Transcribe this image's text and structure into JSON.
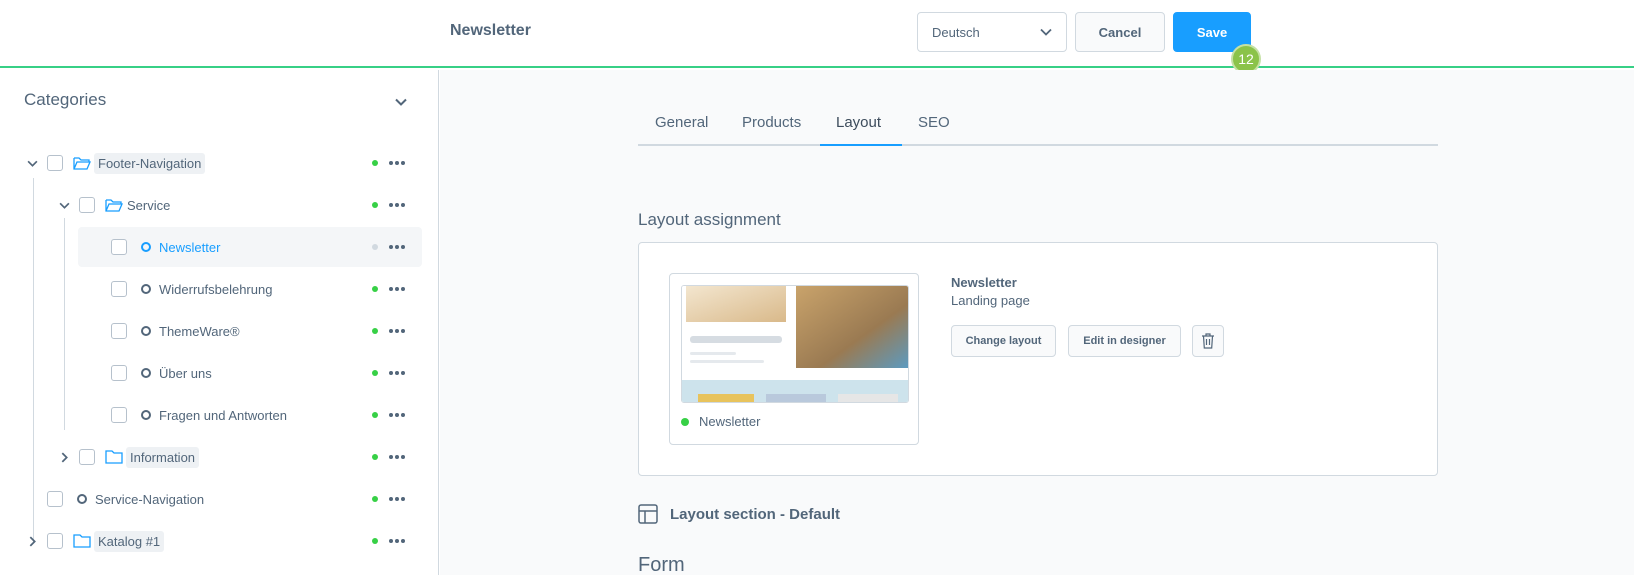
{
  "header": {
    "title": "Newsletter",
    "language": "Deutsch",
    "cancel_label": "Cancel",
    "save_label": "Save",
    "badge": "12"
  },
  "sidebar": {
    "title": "Categories",
    "items": [
      {
        "label": "Footer-Navigation",
        "type": "folder",
        "expanded": true,
        "status": "active"
      },
      {
        "label": "Service",
        "type": "folder",
        "expanded": true,
        "status": "active"
      },
      {
        "label": "Newsletter",
        "type": "page",
        "selected": true,
        "status": "inactive"
      },
      {
        "label": "Widerrufsbelehrung",
        "type": "page",
        "status": "active"
      },
      {
        "label": "ThemeWare®",
        "type": "page",
        "status": "active"
      },
      {
        "label": "Über uns",
        "type": "page",
        "status": "active"
      },
      {
        "label": "Fragen und Antworten",
        "type": "page",
        "status": "active"
      },
      {
        "label": "Information",
        "type": "folder",
        "expanded": false,
        "status": "active"
      },
      {
        "label": "Service-Navigation",
        "type": "page",
        "status": "active"
      },
      {
        "label": "Katalog #1",
        "type": "folder",
        "expanded": false,
        "status": "active"
      }
    ]
  },
  "tabs": [
    {
      "label": "General",
      "active": false
    },
    {
      "label": "Products",
      "active": false
    },
    {
      "label": "Layout",
      "active": true
    },
    {
      "label": "SEO",
      "active": false
    }
  ],
  "layout_assignment": {
    "title": "Layout assignment",
    "preview_status": "Newsletter",
    "layout_name": "Newsletter",
    "layout_type": "Landing page",
    "change_layout_label": "Change layout",
    "edit_designer_label": "Edit in designer"
  },
  "layout_section": {
    "title": "Layout section - Default"
  },
  "form": {
    "title": "Form"
  },
  "colors": {
    "accent": "#189eff",
    "success": "#37d046",
    "header_border": "#37d086",
    "badge": "#8bc34a"
  }
}
